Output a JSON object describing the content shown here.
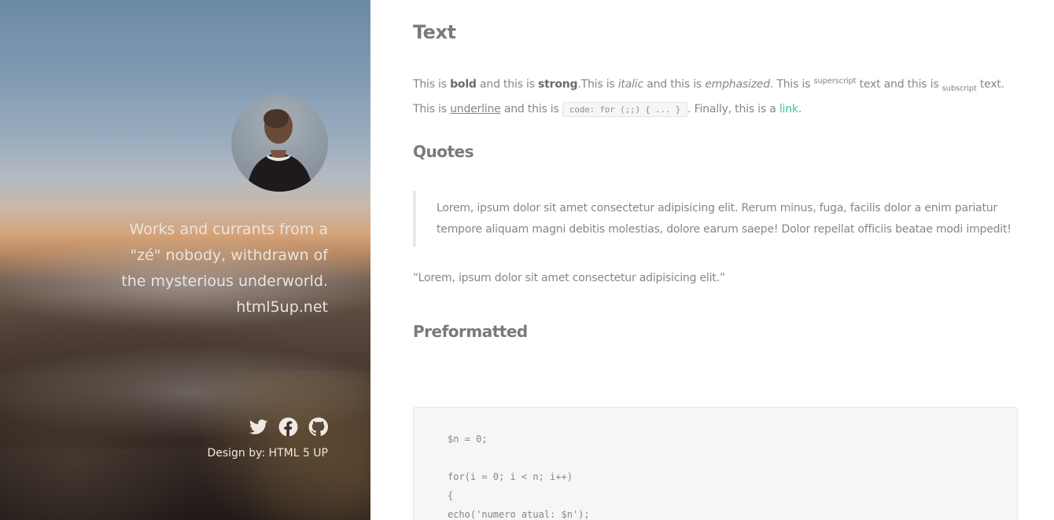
{
  "sidebar": {
    "avatar_alt": "profile photo",
    "tagline": [
      "Works and currants from a",
      "\"zé\" nobody, withdrawn of",
      "the mysterious underworld.",
      "html5up.net"
    ],
    "socials": [
      {
        "name": "twitter-icon"
      },
      {
        "name": "facebook-icon"
      },
      {
        "name": "github-icon"
      }
    ],
    "credit": "Design by: HTML 5 UP"
  },
  "main": {
    "text_heading": "Text",
    "paragraph": {
      "p1": "This is ",
      "bold": "bold",
      "p2": " and this is ",
      "strong": "strong",
      "p3": ".This is ",
      "italic": "italic",
      "p4": " and this is ",
      "emphasized": "emphasized",
      "p5": ". This is ",
      "superscript": "superscript",
      "p6": " text and this is ",
      "subscript": "subscript",
      "p7": " text. This is ",
      "underline": "underline",
      "p8": " and this is ",
      "code": "code: for (;;) { ... }",
      "p9": ". Finally, this is a ",
      "link": "link",
      "p10": "."
    },
    "quotes_heading": "Quotes",
    "blockquote": "Lorem, ipsum dolor sit amet consectetur adipisicing elit. Rerum minus, fuga, facilis dolor a enim pariatur tempore aliquam magni debitis molestias, dolore earum saepe! Dolor repellat officiis beatae modi impedit!",
    "inline_quote": "“Lorem, ipsum dolor sit amet consectetur adipisicing elit.”",
    "pre_heading": "Preformatted",
    "code_lines": [
      "$n = 0;",
      "",
      "for(i = 0; i < n; i++)",
      "{",
      "echo('numero atual: $n');"
    ]
  },
  "colors": {
    "link": "#43c38a",
    "body_text": "#7f888f",
    "heading": "#7a7a7a"
  }
}
